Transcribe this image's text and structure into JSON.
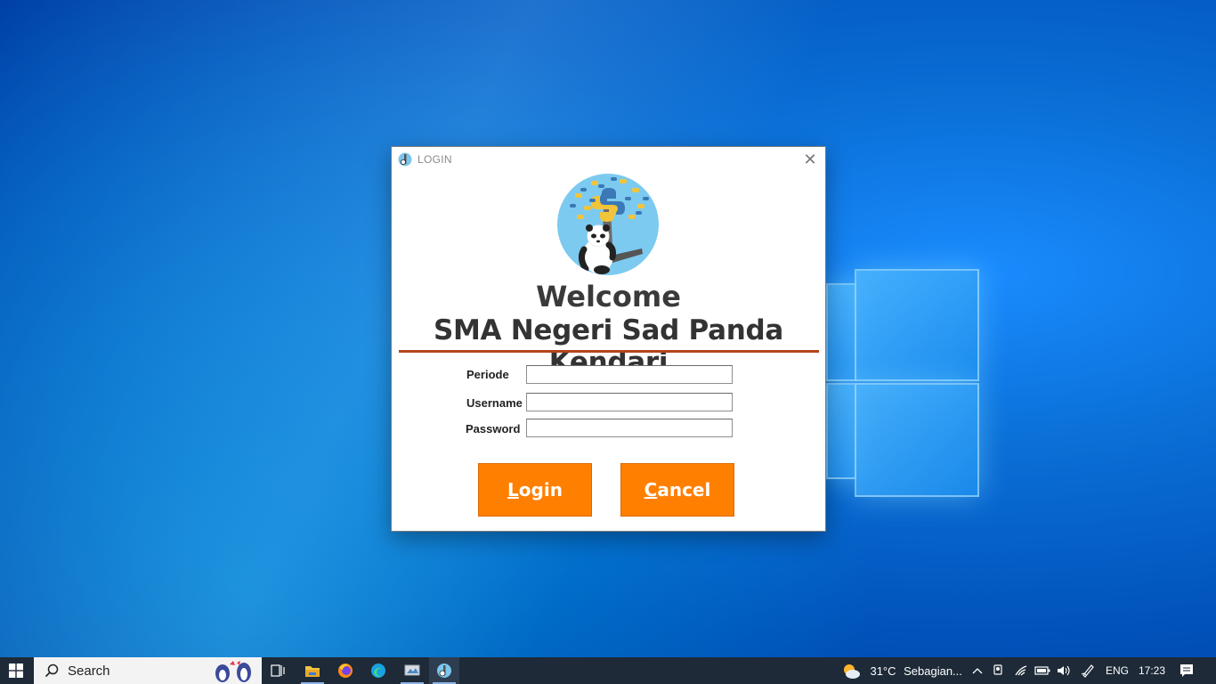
{
  "dialog": {
    "title": "LOGIN",
    "close_glyph": "✕",
    "welcome": "Welcome",
    "school_name": "SMA Negeri Sad Panda Kendari",
    "fields": {
      "periode_label": "Periode",
      "periode_value": "",
      "username_label": "Username",
      "username_value": "",
      "password_label": "Password",
      "password_value": ""
    },
    "buttons": {
      "login_mnemonic": "L",
      "login_rest": "ogin",
      "cancel_mnemonic": "C",
      "cancel_rest": "ancel"
    },
    "colors": {
      "button_bg": "#ff7f00",
      "underline": "#b4451a"
    }
  },
  "taskbar": {
    "search_placeholder": "Search",
    "weather_temp": "31°C",
    "weather_desc": "Sebagian...",
    "language": "ENG",
    "clock": "17:23",
    "icons": [
      "windows-start-icon",
      "search-icon",
      "task-view-icon",
      "file-explorer-icon",
      "firefox-icon",
      "edge-icon",
      "app-icon",
      "python-app-icon"
    ]
  }
}
